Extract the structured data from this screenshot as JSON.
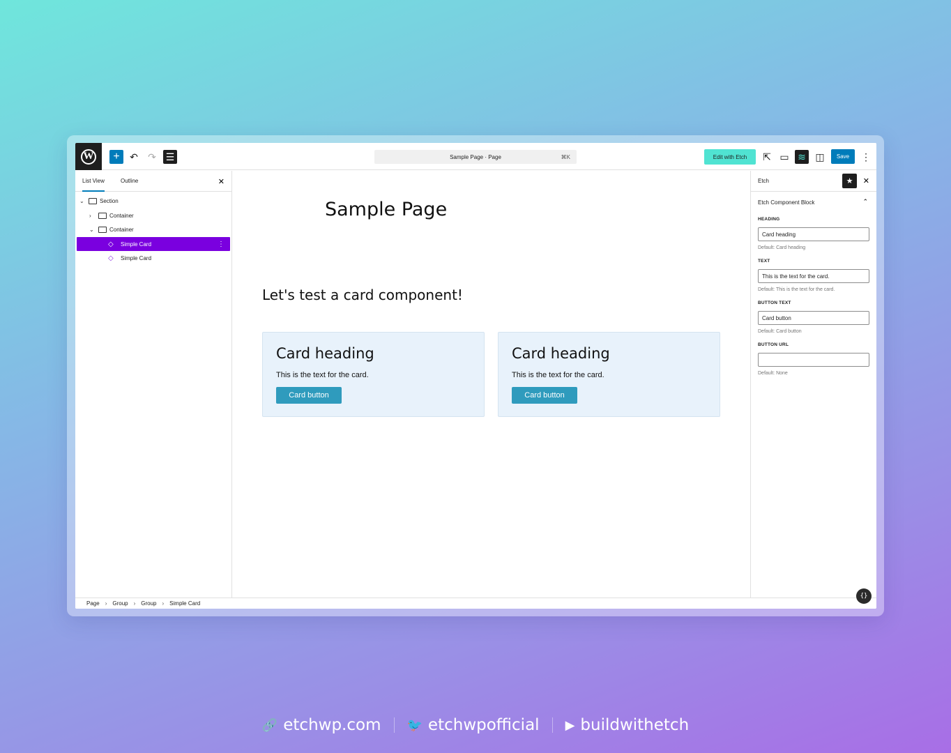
{
  "topbar": {
    "command_bar_title": "Sample Page · Page",
    "command_shortcut": "⌘K",
    "edit_with_etch": "Edit with Etch",
    "save": "Save"
  },
  "left_panel": {
    "tabs": [
      "List View",
      "Outline"
    ],
    "tree": [
      {
        "label": "Section"
      },
      {
        "label": "Container"
      },
      {
        "label": "Container"
      },
      {
        "label": "Simple Card"
      },
      {
        "label": "Simple Card"
      }
    ]
  },
  "canvas": {
    "page_title": "Sample Page",
    "section_heading": "Let's test a card component!",
    "cards": [
      {
        "heading": "Card heading",
        "text": "This is the text for the card.",
        "button": "Card button"
      },
      {
        "heading": "Card heading",
        "text": "This is the text for the card.",
        "button": "Card button"
      }
    ]
  },
  "right_panel": {
    "title": "Etch",
    "section_title": "Etch Component Block",
    "fields": [
      {
        "label": "HEADING",
        "value": "Card heading",
        "help": "Default: Card heading"
      },
      {
        "label": "TEXT",
        "value": "This is the text for the card.",
        "help": "Default: This is the text for the card."
      },
      {
        "label": "BUTTON TEXT",
        "value": "Card button",
        "help": "Default: Card button"
      },
      {
        "label": "BUTTON URL",
        "value": "",
        "help": "Default: None"
      }
    ]
  },
  "breadcrumb": [
    "Page",
    "Group",
    "Group",
    "Simple Card"
  ],
  "footer": {
    "website": "etchwp.com",
    "twitter": "etchwpofficial",
    "youtube": "buildwithetch"
  },
  "colors": {
    "accent": "#007cba",
    "selection": "#7a00df",
    "etch_button": "#50e3d2",
    "card_button": "#2f9bbd",
    "card_bg": "#e8f2fb"
  }
}
